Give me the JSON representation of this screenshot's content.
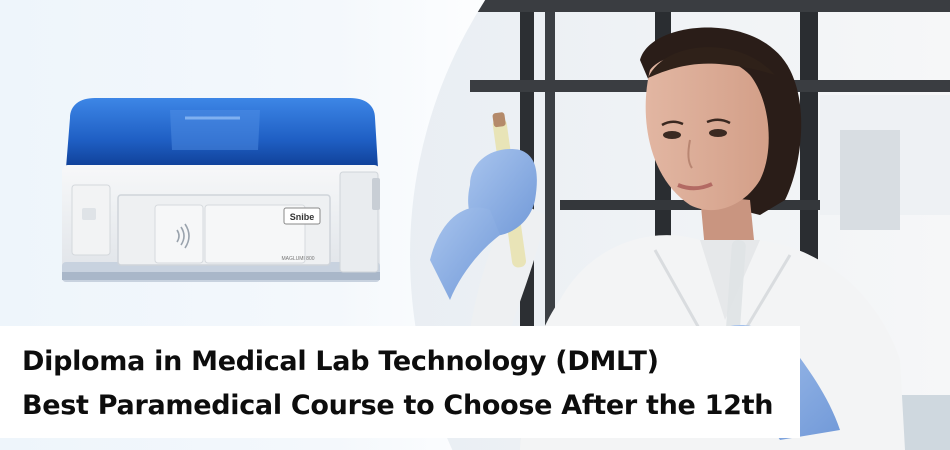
{
  "banner": {
    "headline_line1": "Diploma in Medical Lab Technology (DMLT)",
    "headline_line2": "Best Paramedical Course to Choose After the 12th"
  },
  "analyzer": {
    "brand_label": "Snibe",
    "model_label": "MAGLUMI 800"
  },
  "colors": {
    "analyzer_lid": "#1f5fc4",
    "glove": "#8fb2e6",
    "lab_coat": "#f3f4f5",
    "caption_bg": "#ffffff",
    "caption_text": "#0d0d0d"
  }
}
